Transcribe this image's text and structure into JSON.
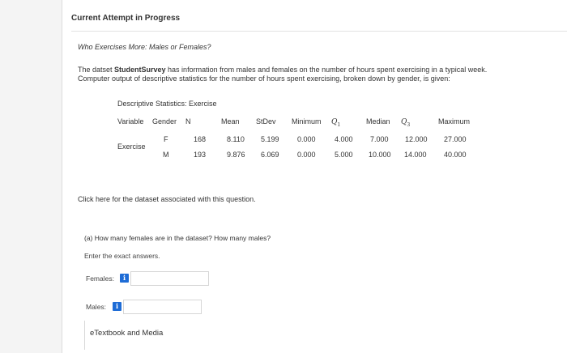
{
  "attempt": {
    "title": "Current Attempt in Progress"
  },
  "question": {
    "title": "Who Exercises More: Males or Females?",
    "intro_prefix": "The datset ",
    "intro_bold": "StudentSurvey",
    "intro_suffix": " has information from males and females on the number of hours spent exercising in a typical week. Computer output of descriptive statistics for the number of hours spent exercising, broken down by gender, is given:"
  },
  "stats": {
    "title": "Descriptive Statistics: Exercise",
    "headers": {
      "variable": "Variable",
      "gender": "Gender",
      "n": "N",
      "mean": "Mean",
      "stdev": "StDev",
      "minimum": "Minimum",
      "q1_letter": "Q",
      "q1_sub": "1",
      "median": "Median",
      "q3_letter": "Q",
      "q3_sub": "3",
      "maximum": "Maximum"
    },
    "variable_name": "Exercise",
    "rows": [
      {
        "gender": "F",
        "n": "168",
        "mean": "8.110",
        "stdev": "5.199",
        "minimum": "0.000",
        "q1": "4.000",
        "median": "7.000",
        "q3": "12.000",
        "maximum": "27.000"
      },
      {
        "gender": "M",
        "n": "193",
        "mean": "9.876",
        "stdev": "6.069",
        "minimum": "0.000",
        "q1": "5.000",
        "median": "10.000",
        "q3": "14.000",
        "maximum": "40.000"
      }
    ]
  },
  "dataset_link": "Click here for the dataset associated with this question.",
  "part_a": {
    "prompt": "(a) How many females are in the dataset? How many males?",
    "instruction": "Enter the exact answers.",
    "females_label": "Females:",
    "males_label": "Males:",
    "info_icon_glyph": "i",
    "females_value": "",
    "males_value": ""
  },
  "footer": {
    "etextbook_label": "eTextbook and Media"
  },
  "colors": {
    "info_button": "#1e6cd6"
  }
}
